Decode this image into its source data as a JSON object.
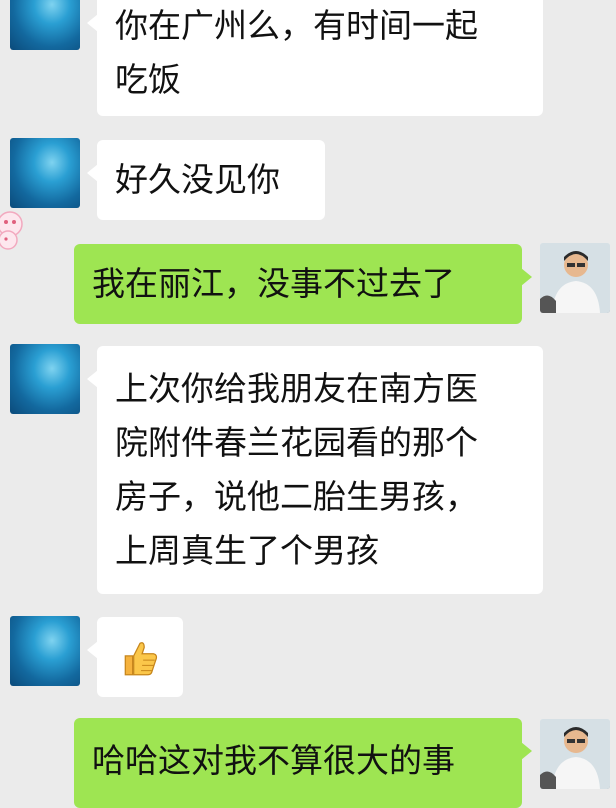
{
  "messages": [
    {
      "side": "left",
      "lines": [
        "你在广州么，有时间一起",
        "吃饭"
      ]
    },
    {
      "side": "left",
      "lines": [
        "好久没见你"
      ]
    },
    {
      "side": "right",
      "lines": [
        "我在丽江，没事不过去了"
      ]
    },
    {
      "side": "left",
      "lines": [
        "上次你给我朋友在南方医",
        "院附件春兰花园看的那个",
        "房子，说他二胎生男孩，",
        "上周真生了个男孩"
      ]
    },
    {
      "side": "left",
      "emoji": "thumbs-up-icon"
    },
    {
      "side": "right",
      "lines": [
        "哈哈这对我不算很大的事"
      ]
    }
  ],
  "colors": {
    "background": "#ebebeb",
    "sent_bubble": "#9ee552",
    "received_bubble": "#ffffff"
  }
}
